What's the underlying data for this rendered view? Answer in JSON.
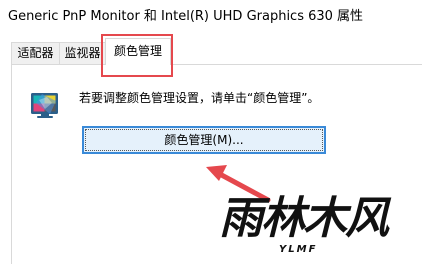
{
  "window": {
    "title": "Generic PnP Monitor 和 Intel(R) UHD Graphics 630 属性"
  },
  "tabs": [
    {
      "label": "适配器",
      "selected": false
    },
    {
      "label": "监视器",
      "selected": false
    },
    {
      "label": "颜色管理",
      "selected": true
    }
  ],
  "color_tab": {
    "description": "若要调整颜色管理设置，请单击“颜色管理”。",
    "button_label": "颜色管理(M)...",
    "icon": "color-management-icon"
  },
  "annotations": {
    "highlight_color": "#e5484d",
    "arrow_color": "#e5484d",
    "arrow_icon": "arrow-pointer-icon"
  },
  "watermark": {
    "main": "雨林木风",
    "sub": "YLMF"
  }
}
